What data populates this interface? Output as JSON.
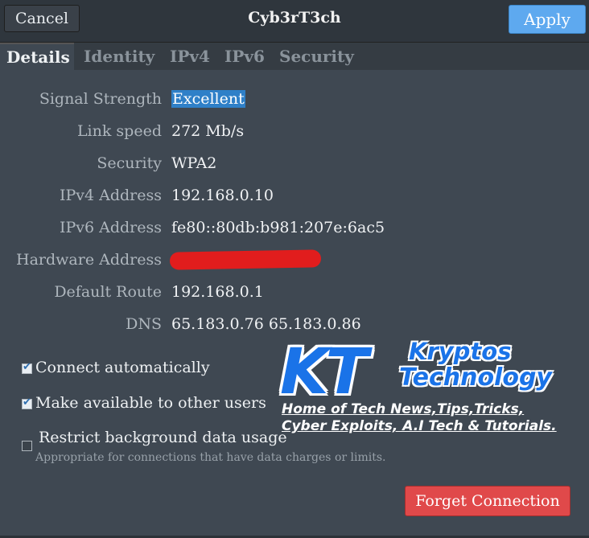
{
  "header": {
    "cancel_label": "Cancel",
    "title": "Cyb3rT3ch",
    "apply_label": "Apply",
    "apply_color": "#5ea9ef"
  },
  "tabs": [
    {
      "label": "Details",
      "active": true
    },
    {
      "label": "Identity",
      "active": false
    },
    {
      "label": "IPv4",
      "active": false
    },
    {
      "label": "IPv6",
      "active": false
    },
    {
      "label": "Security",
      "active": false
    }
  ],
  "details": {
    "signal_strength": {
      "label": "Signal Strength",
      "value": "Excellent"
    },
    "link_speed": {
      "label": "Link speed",
      "value": "272 Mb/s"
    },
    "security": {
      "label": "Security",
      "value": "WPA2"
    },
    "ipv4": {
      "label": "IPv4 Address",
      "value": "192.168.0.10"
    },
    "ipv6": {
      "label": "IPv6 Address",
      "value": "fe80::80db:b981:207e:6ac5"
    },
    "hardware": {
      "label": "Hardware Address",
      "value_redacted": true
    },
    "default_route": {
      "label": "Default Route",
      "value": "192.168.0.1"
    },
    "dns": {
      "label": "DNS",
      "value": "65.183.0.76 65.183.0.86"
    }
  },
  "options": {
    "connect_automatically": {
      "label": "Connect automatically",
      "checked": true
    },
    "make_available": {
      "label": "Make available to other users",
      "checked": true
    },
    "restrict_background": {
      "label": "Restrict background data usage",
      "checked": false,
      "hint": "Appropriate for connections that have data charges or limits."
    }
  },
  "footer": {
    "forget_label": "Forget Connection",
    "forget_color": "#e0494a"
  },
  "watermark": {
    "logo_letters": "KT",
    "name_line1": "Kryptos",
    "name_line2": "Technology",
    "tagline1": "Home of Tech News,Tips,Tricks,",
    "tagline2": "Cyber Exploits, A.I Tech & Tutorials."
  }
}
